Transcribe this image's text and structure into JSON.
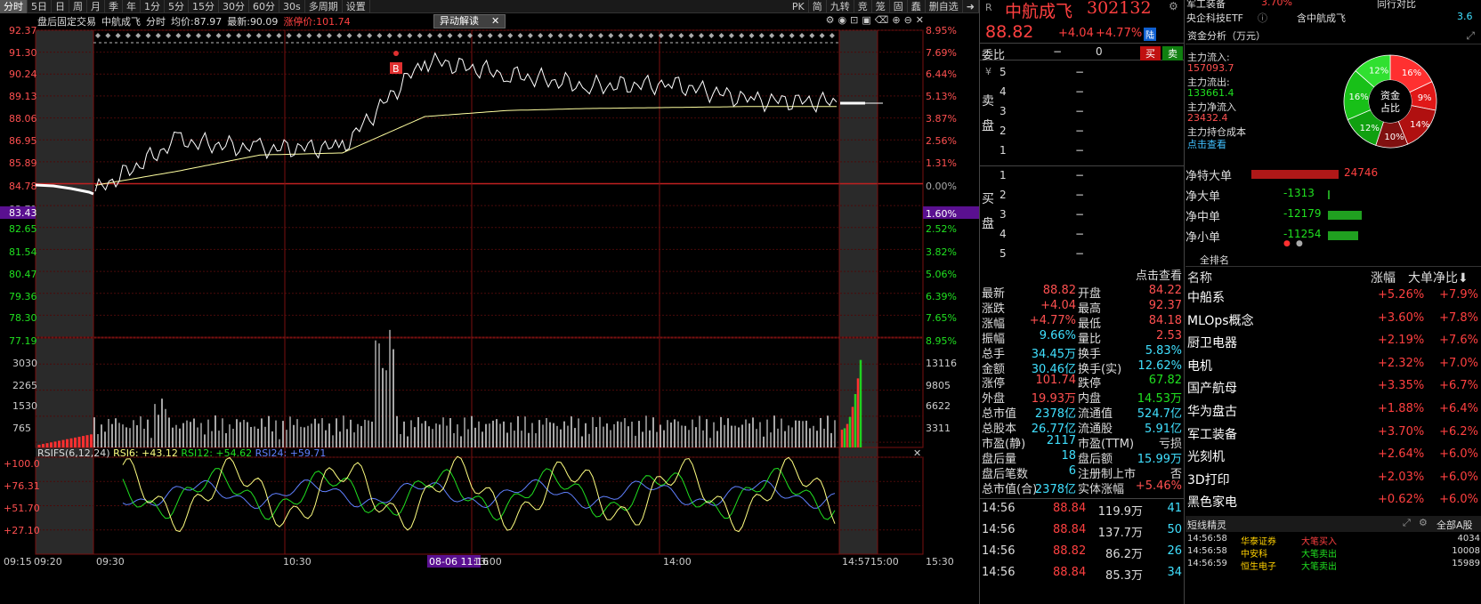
{
  "toolbar": {
    "tabs": [
      "分时",
      "5日",
      "日",
      "周",
      "月",
      "季",
      "年",
      "1分",
      "5分",
      "15分",
      "30分",
      "60分",
      "30s",
      "多周期",
      "设置"
    ],
    "right": [
      "PK",
      "简",
      "九转",
      "竞",
      "笼",
      "固",
      "蠢",
      "删自选"
    ]
  },
  "header": {
    "market": "盘后固定交易",
    "name": "中航成飞",
    "mode": "分时",
    "avg_label": "均价:",
    "avg": "87.97",
    "last_label": "最新:",
    "last": "90.09",
    "limit_label": "涨停价:",
    "limit": "101.74",
    "alert_button": "异动解读",
    "alert_close": "✕"
  },
  "price_axis": {
    "left": [
      "92.37",
      "91.30",
      "90.24",
      "89.13",
      "88.06",
      "86.95",
      "85.89",
      "84.78",
      "83.71",
      "83.43",
      "82.65",
      "81.54",
      "80.47",
      "79.36",
      "78.30",
      "77.19"
    ],
    "right": [
      "8.95%",
      "7.69%",
      "6.44%",
      "5.13%",
      "3.87%",
      "2.56%",
      "1.31%",
      "0.00%",
      "1.60%",
      "2.52%",
      "3.82%",
      "5.06%",
      "6.39%",
      "7.65%",
      "8.95%"
    ]
  },
  "volume_axis": {
    "left": [
      "3030",
      "2265",
      "1530",
      "765"
    ],
    "right": [
      "13116",
      "9805",
      "6622",
      "3311"
    ]
  },
  "rsi": {
    "title": "RSIFS(6,12,24)",
    "rsi6": "RSI6: +43.12",
    "rsi12": "RSI12: +54.62",
    "rsi24": "RSI24: +59.71",
    "ticks": [
      "+100.0",
      "+76.31",
      "+51.70",
      "+27.10"
    ]
  },
  "time_axis": [
    "09:15",
    "09:20",
    "09:30",
    "10:30",
    "08-06 11:16",
    "13:00",
    "14:00",
    "14:57",
    "15:00",
    "15:30"
  ],
  "badge": "B",
  "chart_data": {
    "type": "line",
    "x": [
      "09:30",
      "10:00",
      "10:30",
      "11:00",
      "11:30",
      "13:00",
      "13:30",
      "14:00",
      "14:30",
      "14:57"
    ],
    "series": [
      {
        "values": [
          84.4,
          86.9,
          86.5,
          86.6,
          90.9,
          90.2,
          89.6,
          89.7,
          88.9,
          88.82
        ]
      },
      {
        "values": [
          84.7,
          85.4,
          86.2,
          86.3,
          88.1,
          88.4,
          88.5,
          88.55,
          88.6,
          88.6
        ]
      }
    ],
    "ylim": [
      77.19,
      92.37
    ],
    "colors": {
      "up": "#ff4040",
      "down": "#20e020",
      "price": "#ffffff",
      "avg": "#ffffa0"
    }
  },
  "quote": {
    "name": "中航成飞",
    "code": "302132",
    "price": "88.82",
    "change": "+4.04",
    "pct": "+4.77%",
    "tag": "陆",
    "sector1": "军工装备",
    "sector1_val": "3.70%",
    "sector2": "央企科技ETF",
    "sector3": "同行对比",
    "sector4": "含中航成飞",
    "sector4_val": "3.6"
  },
  "order": {
    "weibi": "委比",
    "weibi_v1": "−",
    "weibi_v2": "0",
    "sell": "买",
    "buy": "卖",
    "sell_label": [
      "卖",
      "盘"
    ],
    "buy_label": [
      "买",
      "盘"
    ],
    "asks": [
      "5",
      "4",
      "3",
      "2",
      "1"
    ],
    "bids": [
      "1",
      "2",
      "3",
      "4",
      "5"
    ],
    "dash": "−",
    "yen": "¥"
  },
  "funds": {
    "title": "资金分析（万元）",
    "inflow_l": "主力流入:",
    "inflow": "157093.7",
    "outflow_l": "主力流出:",
    "outflow": "133661.4",
    "net_l": "主力净流入",
    "net": "23432.4",
    "cost_l": "主力持仓成本",
    "link": "点击查看",
    "pie_center": [
      "资金",
      "占比"
    ],
    "pie_labels": [
      "16%",
      "9%",
      "14%",
      "10%",
      "12%",
      "16%",
      "12%"
    ]
  },
  "netbig": [
    {
      "label": "净特大单",
      "value": "24746"
    },
    {
      "label": "净大单",
      "value": "-1313"
    },
    {
      "label": "净中单",
      "value": "-12179"
    },
    {
      "label": "净小单",
      "value": "-11254"
    }
  ],
  "stats": {
    "link": "点击查看",
    "rows": [
      [
        "最新",
        "88.82",
        "开盘",
        "84.22"
      ],
      [
        "涨跌",
        "+4.04",
        "最高",
        "92.37"
      ],
      [
        "涨幅",
        "+4.77%",
        "最低",
        "84.18"
      ],
      [
        "振幅",
        "9.66%",
        "量比",
        "2.53"
      ],
      [
        "总手",
        "34.45万",
        "换手",
        "5.83%"
      ],
      [
        "金额",
        "30.46亿",
        "换手(实)",
        "12.62%"
      ],
      [
        "涨停",
        "101.74",
        "跌停",
        "67.82"
      ],
      [
        "外盘",
        "19.93万",
        "内盘",
        "14.53万"
      ],
      [
        "总市值",
        "2378亿",
        "流通值",
        "524.7亿"
      ],
      [
        "总股本",
        "26.77亿",
        "流通股",
        "5.91亿"
      ],
      [
        "市盈(静)",
        "2117",
        "市盈(TTM)",
        "亏损"
      ],
      [
        "盘后量",
        "18",
        "盘后额",
        "15.99万"
      ],
      [
        "盘后笔数",
        "6",
        "注册制上市",
        "否"
      ],
      [
        "总市值(合)",
        "2378亿",
        "实体涨幅",
        "+5.46%"
      ]
    ]
  },
  "ticks": [
    [
      "14:56",
      "88.84",
      "119.9万",
      "41"
    ],
    [
      "14:56",
      "88.84",
      "137.7万",
      "50"
    ],
    [
      "14:56",
      "88.82",
      "86.2万",
      "26"
    ],
    [
      "14:56",
      "88.84",
      "85.3万",
      "34"
    ]
  ],
  "ranking": {
    "title": "全排名",
    "headers": [
      "名称",
      "涨幅",
      "大单净比"
    ],
    "rows": [
      [
        "中船系",
        "+5.26%",
        "+7.9%"
      ],
      [
        "MLOps概念",
        "+3.60%",
        "+7.8%"
      ],
      [
        "厨卫电器",
        "+2.19%",
        "+7.6%"
      ],
      [
        "电机",
        "+2.32%",
        "+7.0%"
      ],
      [
        "国产航母",
        "+3.35%",
        "+6.7%"
      ],
      [
        "华为盘古",
        "+1.88%",
        "+6.4%"
      ],
      [
        "军工装备",
        "+3.70%",
        "+6.2%"
      ],
      [
        "光刻机",
        "+2.64%",
        "+6.0%"
      ],
      [
        "3D打印",
        "+2.03%",
        "+6.0%"
      ],
      [
        "黑色家电",
        "+0.62%",
        "+6.0%"
      ]
    ]
  },
  "sprite": {
    "title": "短线精灵",
    "filter": "全部A股",
    "rows": [
      [
        "14:56:58",
        "华泰证券",
        "大笔买入",
        "4034"
      ],
      [
        "14:56:58",
        "中安科",
        "大笔卖出",
        "10008"
      ],
      [
        "14:56:59",
        "恒生电子",
        "大笔卖出",
        "15989"
      ]
    ]
  }
}
